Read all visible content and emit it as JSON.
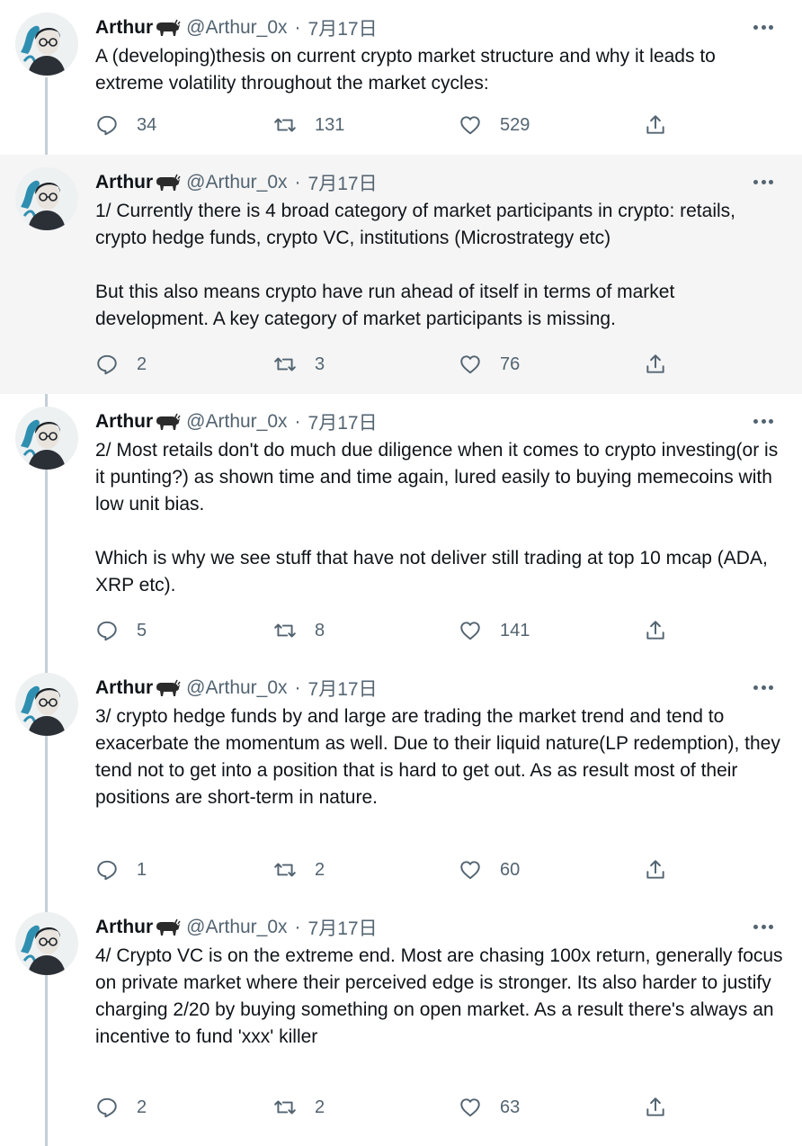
{
  "author": {
    "name": "Arthur",
    "handle": "@Arthur_0x",
    "separator": "·",
    "date": "7月17日",
    "avatar_icon": "anime-avatar-icon",
    "badge_icon": "ox-emoji-icon"
  },
  "colors": {
    "text": "#0f1419",
    "muted": "#536471",
    "thread_line": "#c4cfd6",
    "highlight_bg": "#f5f5f5"
  },
  "tweets": [
    {
      "text": "A (developing)thesis on current crypto market structure and why it leads to extreme volatility throughout the market cycles:",
      "replies": "34",
      "retweets": "131",
      "likes": "529"
    },
    {
      "text": "1/ Currently there is 4 broad category of market participants in crypto: retails, crypto hedge funds, crypto VC, institutions (Microstrategy etc)\n\nBut this also means crypto have run ahead of itself in terms of market development. A key category of market participants is missing.",
      "replies": "2",
      "retweets": "3",
      "likes": "76"
    },
    {
      "text": "2/ Most retails don't do much due diligence when it comes to crypto investing(or is it punting?) as shown time and time again, lured easily to buying memecoins with low unit bias.\n\nWhich is why we see stuff that have not deliver still trading at top 10 mcap (ADA, XRP etc).",
      "replies": "5",
      "retweets": "8",
      "likes": "141"
    },
    {
      "text": "3/ crypto hedge funds by and large are trading the market trend and tend to exacerbate the momentum as well. Due to their liquid nature(LP redemption), they tend not to get into a position that is hard to get out. As as result most of their positions are short-term in nature.",
      "replies": "1",
      "retweets": "2",
      "likes": "60"
    },
    {
      "text": "4/ Crypto VC is on the extreme end. Most are chasing 100x return, generally focus on private market where their perceived edge is stronger. Its also harder to justify charging 2/20 by buying something on open market. As a result there's always an incentive to fund 'xxx' killer",
      "replies": "2",
      "retweets": "2",
      "likes": "63"
    }
  ]
}
